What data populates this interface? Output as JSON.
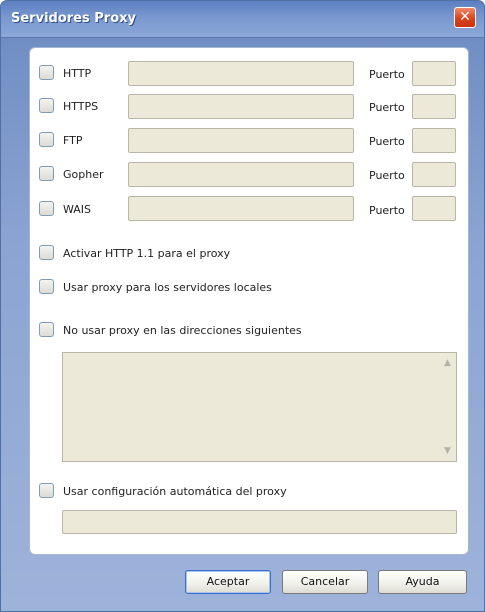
{
  "window": {
    "title": "Servidores Proxy",
    "close_icon": "close-icon"
  },
  "proxies": [
    {
      "label": "HTTP",
      "port_label": "Puerto",
      "value": "",
      "port": ""
    },
    {
      "label": "HTTPS",
      "port_label": "Puerto",
      "value": "",
      "port": ""
    },
    {
      "label": "FTP",
      "port_label": "Puerto",
      "value": "",
      "port": ""
    },
    {
      "label": "Gopher",
      "port_label": "Puerto",
      "value": "",
      "port": ""
    },
    {
      "label": "WAIS",
      "port_label": "Puerto",
      "value": "",
      "port": ""
    }
  ],
  "options": {
    "http11": "Activar HTTP 1.1 para el proxy",
    "local": "Usar proxy para los servidores locales",
    "bypass": "No usar proxy en las direcciones siguientes",
    "bypass_list": "",
    "auto": "Usar configuración automática del proxy",
    "auto_url": ""
  },
  "buttons": {
    "ok": "Aceptar",
    "cancel": "Cancelar",
    "help": "Ayuda"
  },
  "scroll_icons": {
    "up": "▲",
    "down": "▼"
  }
}
